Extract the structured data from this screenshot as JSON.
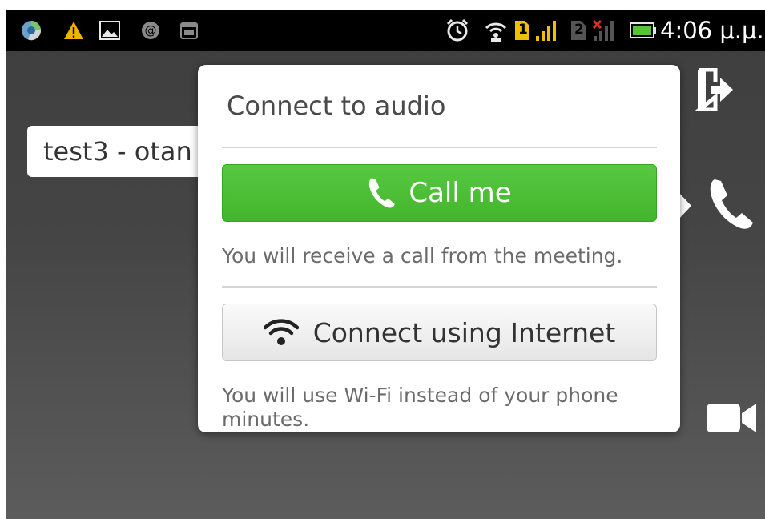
{
  "status_bar": {
    "time": "4:06 μ.μ.",
    "sim1_label": "1",
    "sim2_label": "2",
    "icons": [
      "chrome-orb-icon",
      "warning-icon",
      "gallery-icon",
      "at-sign-icon",
      "calendar-icon",
      "alarm-icon",
      "wifi-hotspot-icon",
      "sim1-icon",
      "signal-icon",
      "sim2-icon",
      "no-signal-icon",
      "battery-icon"
    ]
  },
  "meeting": {
    "title": "test3 - otan"
  },
  "popup": {
    "title": "Connect to audio",
    "call_me": {
      "label": "Call me",
      "icon": "phone-icon",
      "helper": "You will receive a call from the meeting."
    },
    "internet": {
      "label": "Connect using Internet",
      "icon": "wifi-icon",
      "helper": "You will use Wi-Fi instead of your phone minutes."
    }
  },
  "toolbar": {
    "icons": [
      "leave-meeting-icon",
      "phone-icon",
      "video-camera-icon"
    ]
  },
  "colors": {
    "call_button": "#4fbf38",
    "background": "#444444",
    "status_bar": "#000000"
  }
}
